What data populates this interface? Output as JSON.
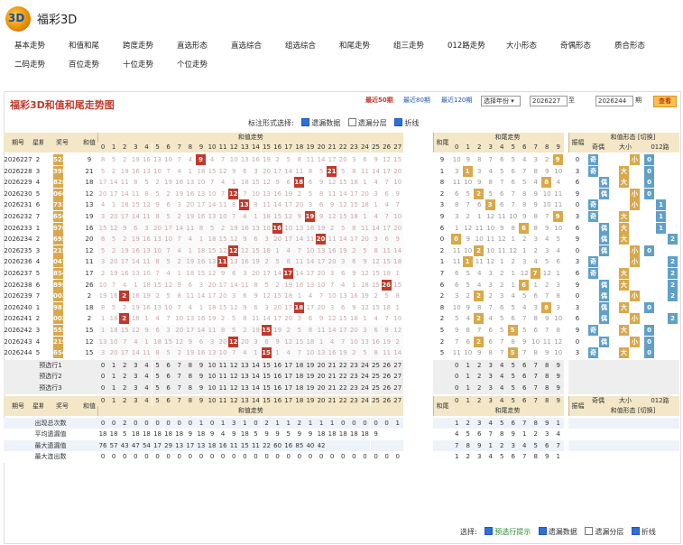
{
  "brand": "福彩3D",
  "nav": [
    "基本走势",
    "和值和尾",
    "跨度走势",
    "直选形态",
    "直选综合",
    "组选综合",
    "和尾走势",
    "组三走势",
    "012路走势",
    "大小形态",
    "奇偶形态",
    "质合形态",
    "二码走势",
    "百位走势",
    "十位走势",
    "个位走势"
  ],
  "panel": {
    "title": "福彩3D和值和尾走势图",
    "recent50": "最近50期",
    "recent80": "最近80期",
    "recent120": "最近120期",
    "select": "选择年份",
    "from": "2026227",
    "to_label": "至",
    "to": "2026244",
    "unit": "期",
    "query": "查看"
  },
  "options": {
    "label": "标注形式选择:",
    "o1": "遗漏数据",
    "o2": "遗漏分层",
    "o3": "折线"
  },
  "footer": {
    "label": "选择:",
    "f1": "预选行提示",
    "f2": "遗漏数据",
    "f3": "遗漏分层",
    "f4": "折线"
  },
  "headers": {
    "period": "期号",
    "week": "星期",
    "prize": "奖号",
    "sum": "和值",
    "sumtrend": "和值走势",
    "tail": "和尾",
    "tailtrend": "和尾走势",
    "span": "振幅",
    "oe": "奇偶",
    "bs": "大小",
    "r012": "012路",
    "shape": "和值形态",
    "switch": "切换",
    "odd": "奇",
    "even": "偶",
    "big": "大",
    "small": "小"
  },
  "rows": [
    {
      "p": "2026227",
      "w": "2",
      "n": "522",
      "s": 9
    },
    {
      "p": "2026228",
      "w": "3",
      "n": "399",
      "s": 21
    },
    {
      "p": "2026229",
      "w": "4",
      "n": "828",
      "s": 18
    },
    {
      "p": "2026230",
      "w": "5",
      "n": "066",
      "s": 12
    },
    {
      "p": "2026231",
      "w": "6",
      "n": "733",
      "s": 13
    },
    {
      "p": "2026232",
      "w": "7",
      "n": "658",
      "s": 19
    },
    {
      "p": "2026233",
      "w": "1",
      "n": "970",
      "s": 16
    },
    {
      "p": "2026234",
      "w": "2",
      "n": "695",
      "s": 20
    },
    {
      "p": "2026235",
      "w": "3",
      "n": "219",
      "s": 12
    },
    {
      "p": "2026236",
      "w": "4",
      "n": "047",
      "s": 11
    },
    {
      "p": "2026237",
      "w": "5",
      "n": "854",
      "s": 17
    },
    {
      "p": "2026238",
      "w": "6",
      "n": "899",
      "s": 26
    },
    {
      "p": "2026239",
      "w": "7",
      "n": "002",
      "s": 2
    },
    {
      "p": "2026240",
      "w": "1",
      "n": "981",
      "s": 18
    },
    {
      "p": "2026241",
      "w": "2",
      "n": "002",
      "s": 2
    },
    {
      "p": "2026242",
      "w": "3",
      "n": "555",
      "s": 15
    },
    {
      "p": "2026243",
      "w": "4",
      "n": "219",
      "s": 12
    },
    {
      "p": "2026244",
      "w": "5",
      "n": "654",
      "s": 15
    }
  ],
  "presel": [
    "预选行1",
    "预选行2",
    "预选行3"
  ],
  "stats": [
    {
      "label": "出现总次数",
      "v": "0 0 2 0 0 0 0 0 0 1 0 1 3 1 0 2 1 1 2 1 1 1 0 0 0 0 0 1"
    },
    {
      "label": "平均遗漏值",
      "v": "18 18 5 18 18 18 18 18 9 18 9 4 9 18 5 9 9 5 9 9 18 18 18 18 18 9"
    },
    {
      "label": "最大遗漏值",
      "v": "76 57 43 47 54 17 29 13 17 13 18 16 11 15 11 22 60 16 85 40 42"
    },
    {
      "label": "最大连出数",
      "v": "0 0 0 0 0 0 0 0 0 0 0 0 0 0 0 0 0 0 0 0 0 0 0 0 0 0 0 0"
    }
  ]
}
